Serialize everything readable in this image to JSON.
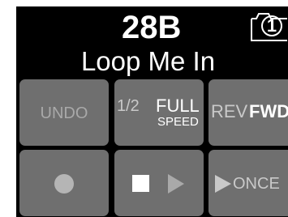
{
  "preset": {
    "number": "28B",
    "name": "Loop Me In",
    "snapshot_number": "1"
  },
  "buttons": {
    "undo": {
      "label": "UNDO"
    },
    "speed": {
      "half_label": "1/2",
      "full_label": "FULL",
      "sub_label": "SPEED"
    },
    "direction": {
      "rev_label": "REV",
      "fwd_label": "FWD"
    },
    "record": {
      "icon": "record-dot-icon"
    },
    "stop_play": {
      "stop_icon": "stop-icon",
      "play_icon": "play-icon"
    },
    "once": {
      "icon": "play-icon",
      "label": "ONCE"
    }
  },
  "colors": {
    "background": "#000000",
    "button": "#6f6f6f",
    "active_text": "#ffffff",
    "inactive_text": "#a9a9a9"
  }
}
